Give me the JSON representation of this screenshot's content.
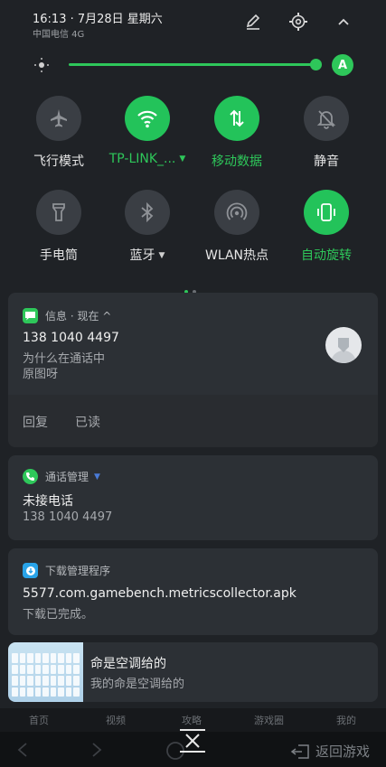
{
  "status": {
    "time": "16:13 · 7月28日 星期六",
    "carrier": "中国电信 4G"
  },
  "header_icons": [
    "edit-icon",
    "settings-icon",
    "collapse-icon"
  ],
  "brightness": {
    "level_percent": 100,
    "auto_label": "A"
  },
  "tiles": [
    {
      "id": "airplane",
      "label": "飞行模式",
      "on": false,
      "has_caret": false
    },
    {
      "id": "wifi",
      "label": "TP-LINK_...",
      "on": true,
      "has_caret": true
    },
    {
      "id": "mobile-data",
      "label": "移动数据",
      "on": true,
      "has_caret": false
    },
    {
      "id": "silent",
      "label": "静音",
      "on": false,
      "has_caret": false
    },
    {
      "id": "flashlight",
      "label": "手电筒",
      "on": false,
      "has_caret": false
    },
    {
      "id": "bluetooth",
      "label": "蓝牙",
      "on": false,
      "has_caret": true
    },
    {
      "id": "hotspot",
      "label": "WLAN热点",
      "on": false,
      "has_caret": false
    },
    {
      "id": "autorotate",
      "label": "自动旋转",
      "on": true,
      "has_caret": false
    }
  ],
  "colors": {
    "accent": "#2ec75a",
    "card_bg": "#2c3035",
    "panel_bg": "#1f2226"
  },
  "notifications": {
    "messages": {
      "app": "信息 · 现在 ^",
      "title": "138 1040 4497",
      "line1": "为什么在通话中",
      "line2": "原图呀",
      "action_reply": "回复",
      "action_read": "已读"
    },
    "calls": {
      "app": "通话管理",
      "title": "未接电话",
      "body": "138 1040 4497"
    },
    "downloads": {
      "app": "下载管理程序",
      "title": "5577.com.gamebench.metricscollector.apk",
      "body": "下载已完成。"
    },
    "game": {
      "title": "命是空调给的",
      "body": "我的命是空调给的"
    }
  },
  "bottom_nav": [
    "首页",
    "视频",
    "攻略",
    "游戏圈",
    "我的"
  ],
  "system_nav": {
    "back_to_game": "返回游戏"
  }
}
